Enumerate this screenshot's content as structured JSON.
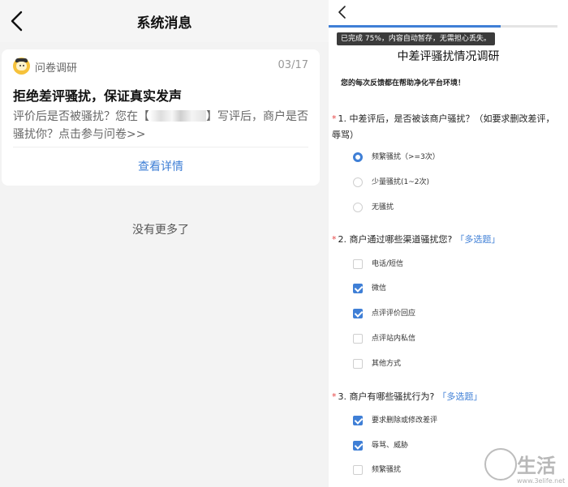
{
  "left_panel": {
    "header": {
      "title": "系统消息"
    },
    "card": {
      "source": "问卷调研",
      "date": "03/17",
      "title": "拒绝差评骚扰，保证真实发声",
      "body_part1": "评价后是否被骚扰？您在【",
      "body_part2": "】写评后，商户是否骚扰你？点击参与问卷>>",
      "action": "查看详情"
    },
    "footer_text": "没有更多了"
  },
  "right_panel": {
    "progress": {
      "percent": 75,
      "tip": "已完成 75%，内容自动暂存，无需担心丢失。"
    },
    "survey_title": "中差评骚扰情况调研",
    "survey_desc": "您的每次反馈都在帮助净化平台环境！",
    "questions": [
      {
        "star": "*",
        "text": "1. 中差评后，是否被该商户骚扰？（如要求删改差评，辱骂）",
        "type": "single",
        "options": [
          {
            "label": "频繁骚扰（>=3次）",
            "checked": true
          },
          {
            "label": "少量骚扰(1~2次)",
            "checked": false
          },
          {
            "label": "无骚扰",
            "checked": false
          }
        ]
      },
      {
        "star": "*",
        "text": "2. 商户通过哪些渠道骚扰您?",
        "tag": "「多选题」",
        "type": "multi",
        "options": [
          {
            "label": "电话/短信",
            "checked": false
          },
          {
            "label": "微信",
            "checked": true
          },
          {
            "label": "点评评价回应",
            "checked": true
          },
          {
            "label": "点评站内私信",
            "checked": false
          },
          {
            "label": "其他方式",
            "checked": false
          }
        ]
      },
      {
        "star": "*",
        "text": "3. 商户有哪些骚扰行为?",
        "tag": "「多选题」",
        "type": "multi",
        "options": [
          {
            "label": "要求删除或修改差评",
            "checked": true
          },
          {
            "label": "辱骂、威胁",
            "checked": true
          },
          {
            "label": "频繁骚扰",
            "checked": false
          }
        ]
      }
    ]
  },
  "watermark": {
    "text": "生活",
    "url": "www.3elife.net"
  },
  "colors": {
    "accent": "#3f7fd6",
    "required": "#e64545",
    "background": "#f3f3f3"
  },
  "icons": {
    "back": "chevron-left-icon",
    "source": "survey-mascot-icon",
    "watermark": "logo-circle-icon"
  }
}
